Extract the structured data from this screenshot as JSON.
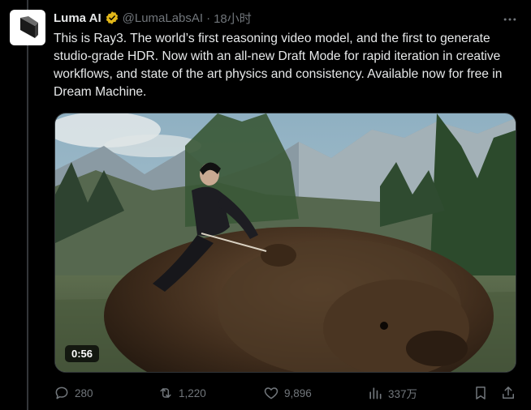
{
  "author": {
    "name": "Luma AI",
    "handle": "@LumaLabsAI",
    "time": "18小时",
    "verified_color": "#e2b719"
  },
  "tweet": {
    "text": "This is Ray3. The world’s first reasoning video model, and the first to generate studio-grade HDR. Now with an all-new Draft Mode for rapid iteration in creative workflows, and state of the art physics and consistency. Available now for free in Dream Machine."
  },
  "media": {
    "duration": "0:56"
  },
  "actions": {
    "replies": "280",
    "retweets": "1,220",
    "likes": "9,896",
    "views": "337万"
  },
  "icons": {
    "more": "more-icon",
    "reply": "reply-icon",
    "retweet": "retweet-icon",
    "like": "like-icon",
    "views": "views-icon",
    "bookmark": "bookmark-icon",
    "share": "share-icon"
  },
  "colors": {
    "background": "#000000",
    "text": "#e7e9ea",
    "muted": "#71767b",
    "border": "#2f3336"
  }
}
